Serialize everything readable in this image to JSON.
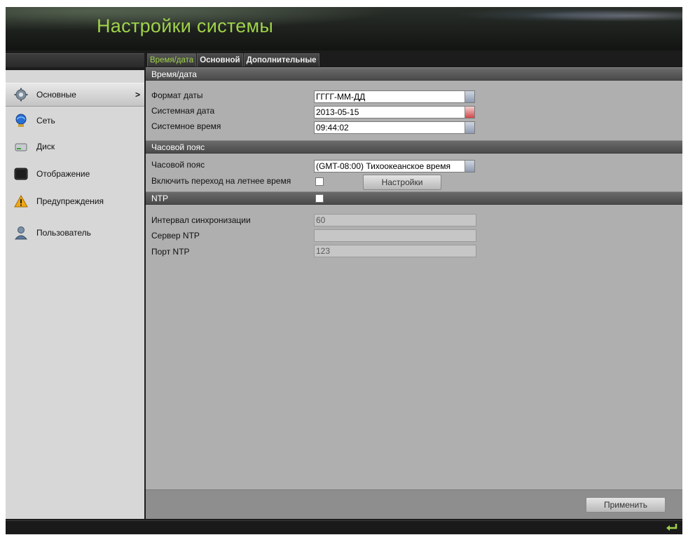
{
  "header": {
    "title": "Настройки системы"
  },
  "tabs": [
    {
      "label": "Время/дата",
      "active": true
    },
    {
      "label": "Основной",
      "active": false
    },
    {
      "label": "Дополнительные",
      "active": false
    }
  ],
  "sidebar": {
    "items": [
      {
        "label": "Основные",
        "icon": "gear-icon",
        "active": true,
        "chevron": ">"
      },
      {
        "label": "Сеть",
        "icon": "network-globe-icon",
        "active": false
      },
      {
        "label": "Диск",
        "icon": "hard-disk-icon",
        "active": false
      },
      {
        "label": "Отображение",
        "icon": "monitor-icon",
        "active": false
      },
      {
        "label": "Предупреждения",
        "icon": "warning-icon",
        "active": false
      },
      {
        "label": "Пользователь",
        "icon": "user-icon",
        "active": false
      }
    ]
  },
  "sections": {
    "datetime": {
      "title": "Время/дата",
      "date_format_label": "Формат даты",
      "date_format_value": "ГГГГ-ММ-ДД",
      "system_date_label": "Системная дата",
      "system_date_value": "2013-05-15",
      "system_time_label": "Системное время",
      "system_time_value": "09:44:02"
    },
    "timezone": {
      "title": "Часовой пояс",
      "tz_label": "Часовой пояс",
      "tz_value": "(GMT-08:00) Тихоокеанское время",
      "dst_label": "Включить переход на летнее время",
      "dst_checked": false,
      "settings_button": "Настройки"
    },
    "ntp": {
      "title": "NTP",
      "enabled": false,
      "interval_label": "Интервал синхронизации",
      "interval_value": "60",
      "server_label": "Сервер NTP",
      "server_value": "",
      "port_label": "Порт NTP",
      "port_value": "123"
    }
  },
  "footer": {
    "apply_button": "Применить"
  },
  "colors": {
    "accent": "#9fd14a",
    "panel": "#afafaf",
    "sidebar": "#d7d7d7"
  }
}
